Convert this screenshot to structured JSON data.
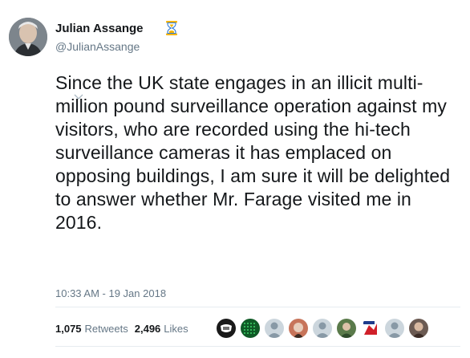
{
  "author": {
    "name": "Julian Assange",
    "handle": "@JulianAssange",
    "badge_icon": "hourglass-icon"
  },
  "tweet": {
    "text": "Since the UK state engages in an illicit multi-million pound surveillance operation against my visitors, who are recorded using the hi-tech surveillance cameras it has emplaced on opposing buildings, I am sure it will be delighted to answer whether Mr. Farage visited me in 2016.",
    "timestamp": "10:33 AM - 19 Jan 2018"
  },
  "stats": {
    "retweets_count": "1,075",
    "retweets_label": "Retweets",
    "likes_count": "2,496",
    "likes_label": "Likes"
  },
  "colors": {
    "text": "#14171a",
    "muted": "#657786",
    "divider": "#e6ecf0",
    "badge": "#f4b400"
  }
}
